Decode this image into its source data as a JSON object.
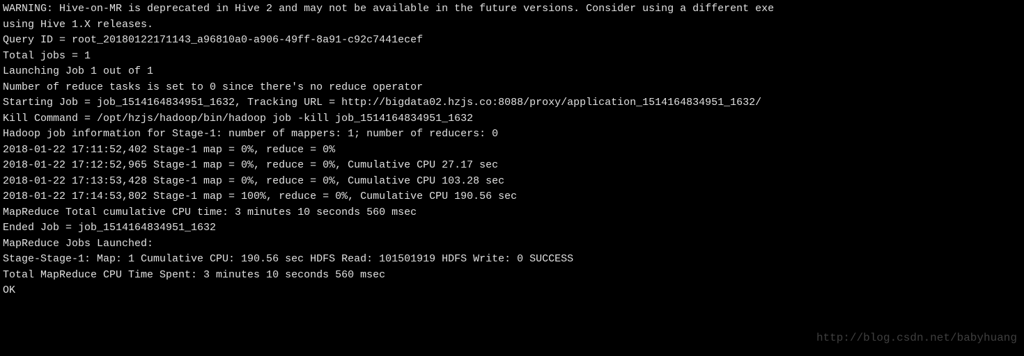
{
  "lines": {
    "l0": "WARNING: Hive-on-MR is deprecated in Hive 2 and may not be available in the future versions. Consider using a different exe",
    "l1": "using Hive 1.X releases.",
    "l2": "Query ID = root_20180122171143_a96810a0-a906-49ff-8a91-c92c7441ecef",
    "l3": "Total jobs = 1",
    "l4": "Launching Job 1 out of 1",
    "l5": "Number of reduce tasks is set to 0 since there's no reduce operator",
    "l6": "Starting Job = job_1514164834951_1632, Tracking URL = http://bigdata02.hzjs.co:8088/proxy/application_1514164834951_1632/",
    "l7": "Kill Command = /opt/hzjs/hadoop/bin/hadoop job  -kill job_1514164834951_1632",
    "l8": "Hadoop job information for Stage-1: number of mappers: 1; number of reducers: 0",
    "l9": "2018-01-22 17:11:52,402 Stage-1 map = 0%,   reduce = 0%",
    "l10": "2018-01-22 17:12:52,965 Stage-1 map = 0%,   reduce = 0%, Cumulative CPU 27.17 sec",
    "l11": "2018-01-22 17:13:53,428 Stage-1 map = 0%,   reduce = 0%, Cumulative CPU 103.28 sec",
    "l12": "2018-01-22 17:14:53,802 Stage-1 map = 100%,   reduce = 0%, Cumulative CPU 190.56 sec",
    "l13": "MapReduce Total cumulative CPU time: 3 minutes 10 seconds 560 msec",
    "l14": "Ended Job = job_1514164834951_1632",
    "l15": "MapReduce Jobs Launched:",
    "l16": "Stage-Stage-1: Map: 1   Cumulative CPU: 190.56 sec   HDFS Read: 101501919 HDFS Write: 0 SUCCESS",
    "l17": "Total MapReduce CPU Time Spent: 3 minutes 10 seconds 560 msec",
    "l18": "OK"
  },
  "watermark": "http://blog.csdn.net/babyhuang"
}
